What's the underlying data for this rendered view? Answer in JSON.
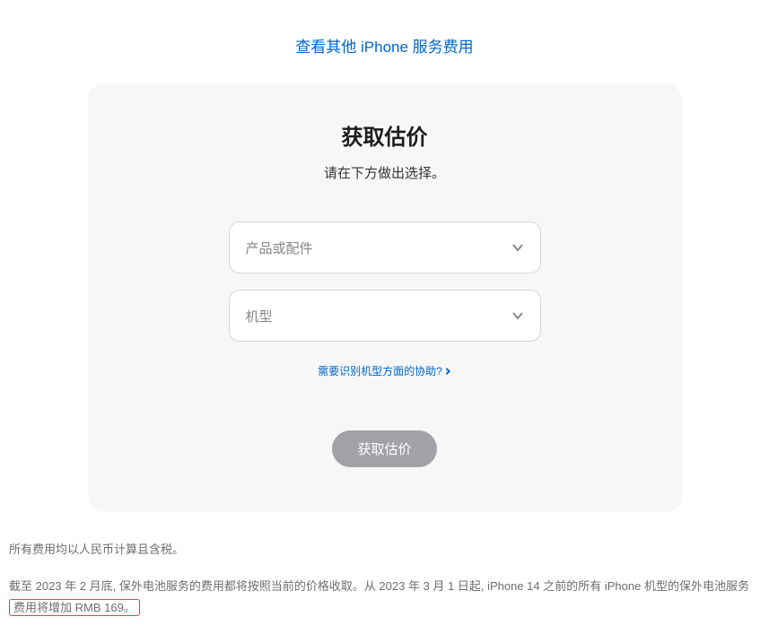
{
  "topLink": "查看其他 iPhone 服务费用",
  "card": {
    "title": "获取估价",
    "subtitle": "请在下方做出选择。",
    "select1": {
      "placeholder": "产品或配件"
    },
    "select2": {
      "placeholder": "机型"
    },
    "helpLink": "需要识别机型方面的协助?",
    "button": "获取估价"
  },
  "footer": {
    "note1": "所有费用均以人民币计算且含税。",
    "note2_part1": "截至 2023 年 2 月底, 保外电池服务的费用都将按照当前的价格收取。从 2023 年 3 月 1 日起, iPhone 14 之前的所有 iPhone 机型的保外电池服务",
    "note2_highlight": "费用将增加 RMB 169。"
  }
}
